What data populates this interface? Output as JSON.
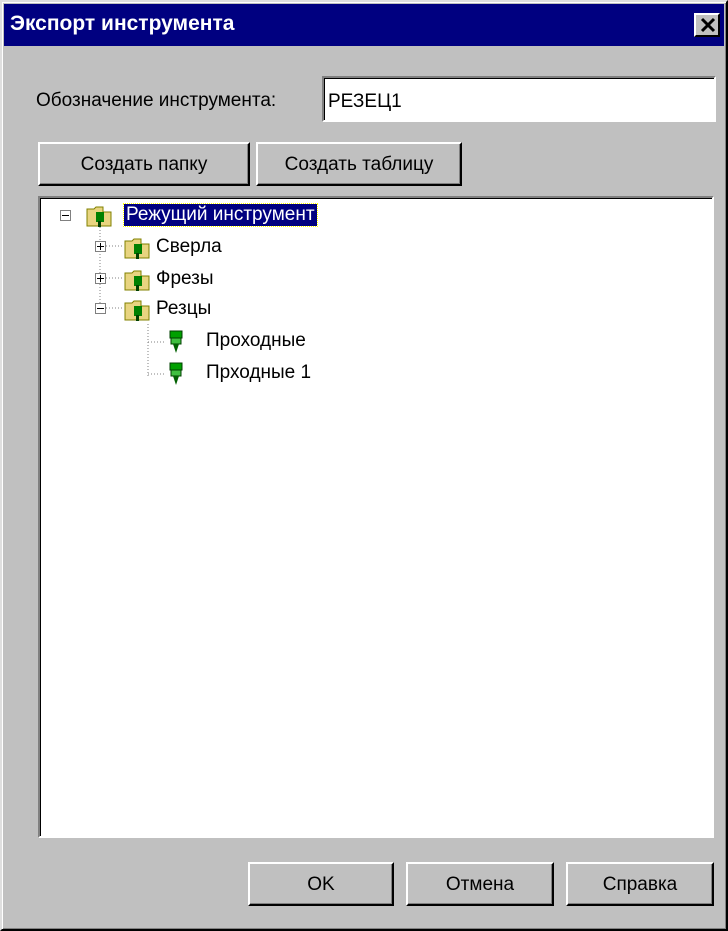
{
  "window": {
    "title": "Экспорт инструмента"
  },
  "designation": {
    "label": "Обозначение инструмента:",
    "value": "РЕЗЕЦ1"
  },
  "toolbar": {
    "create_folder_label": "Создать папку",
    "create_table_label": "Создать таблицу"
  },
  "tree": {
    "root": {
      "label": "Режущий инструмент",
      "selected": true,
      "expanded": true
    },
    "items": [
      {
        "label": "Сверла",
        "expanded": false
      },
      {
        "label": "Фрезы",
        "expanded": false
      },
      {
        "label": "Резцы",
        "expanded": true,
        "children": [
          {
            "label": "Проходные"
          },
          {
            "label": "Прходные 1"
          }
        ]
      }
    ]
  },
  "footer": {
    "ok_label": "OK",
    "cancel_label": "Отмена",
    "help_label": "Справка"
  },
  "colors": {
    "titlebar": "#000080",
    "face": "#c0c0c0",
    "selection": "#000080",
    "folder": "#e8d480",
    "tool": "#00a000"
  }
}
